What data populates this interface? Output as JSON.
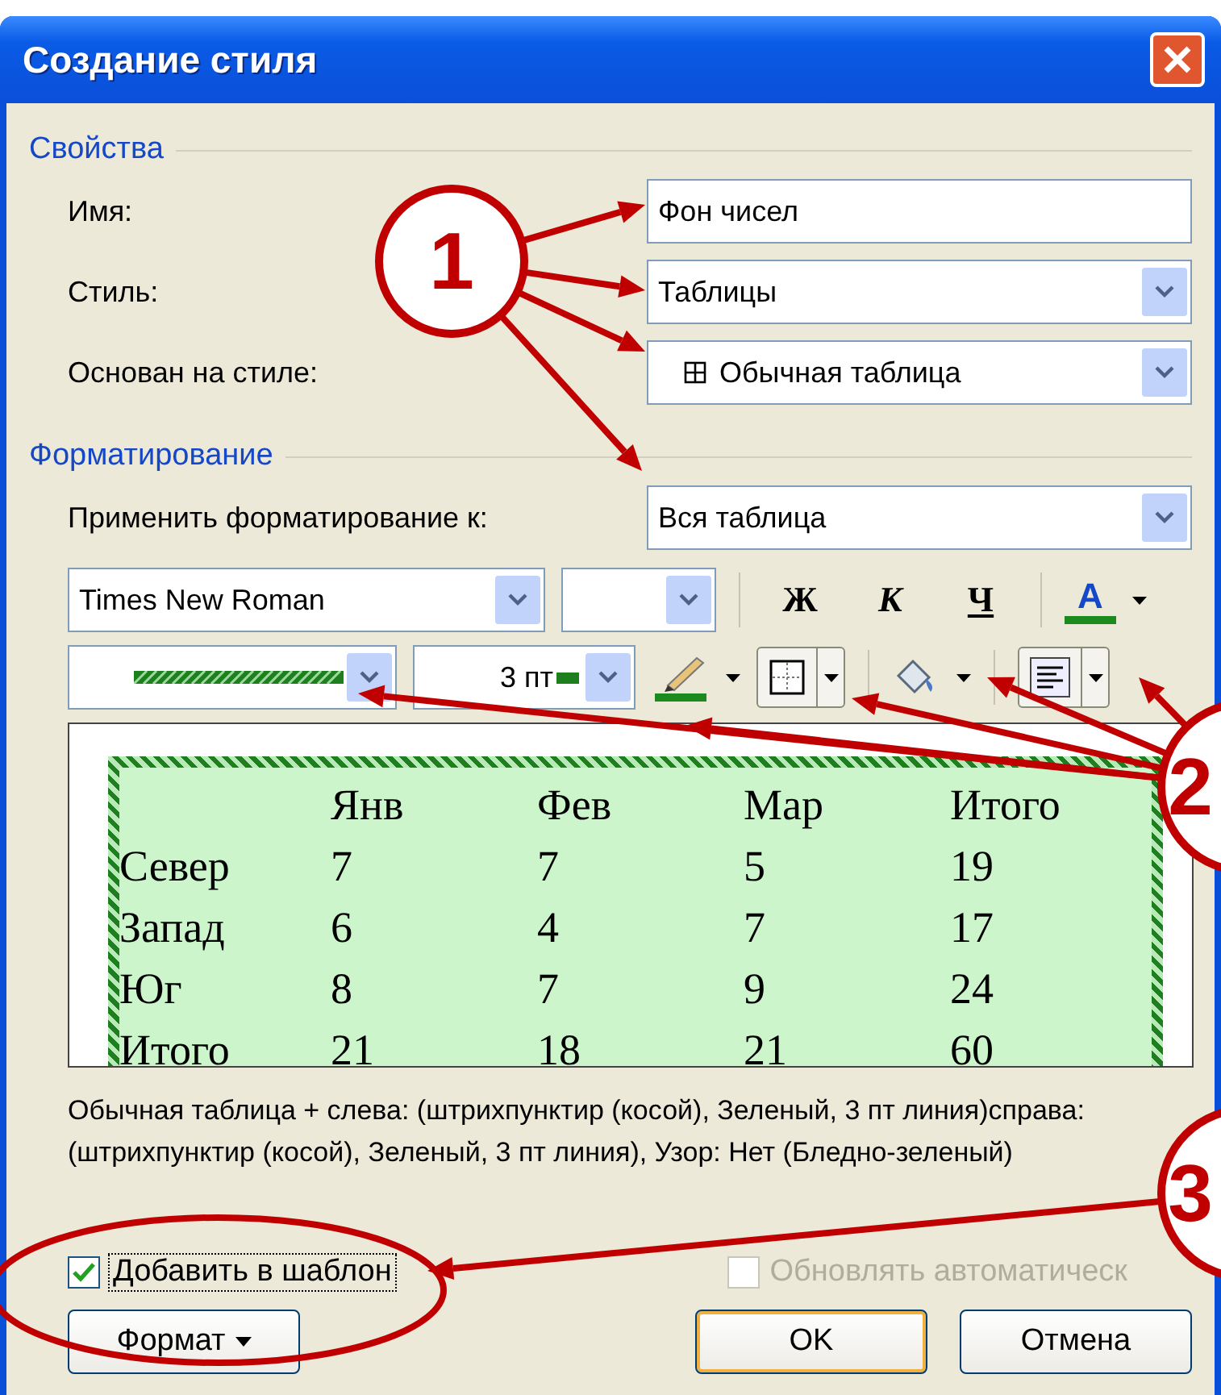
{
  "window": {
    "title": "Создание стиля"
  },
  "properties": {
    "heading": "Свойства",
    "fields": [
      {
        "label": "Имя:",
        "value": "Фон чисел",
        "kind": "text"
      },
      {
        "label": "Стиль:",
        "value": "Таблицы",
        "kind": "combo"
      },
      {
        "label": "Основан на стиле:",
        "value": "Обычная таблица",
        "kind": "table-combo"
      }
    ]
  },
  "formatting": {
    "heading": "Форматирование",
    "apply_to": {
      "label": "Применить форматирование к:",
      "value": "Вся таблица"
    },
    "font": "Times New Roman",
    "format_buttons": [
      "Ж",
      "К",
      "Ч"
    ],
    "font_color_button": "A",
    "border_width": "3 пт",
    "preview": {
      "columns": [
        "",
        "Янв",
        "Фев",
        "Мар",
        "Итого"
      ],
      "rows": [
        [
          "Север",
          "7",
          "7",
          "5",
          "19"
        ],
        [
          "Запад",
          "6",
          "4",
          "7",
          "17"
        ],
        [
          "Юг",
          "8",
          "7",
          "9",
          "24"
        ],
        [
          "Итого",
          "21",
          "18",
          "21",
          "60"
        ]
      ]
    },
    "description": "Обычная таблица + слева: (штрихпунктир (косой), Зеленый,  3 пт линия)справа: (штрихпунктир (косой), Зеленый,  3 пт линия), Узор: Нет (Бледно-зеленый)"
  },
  "options": [
    {
      "label": "Добавить в шаблон",
      "checked": true,
      "disabled": false
    },
    {
      "label": "Обновлять автоматическ",
      "checked": false,
      "disabled": true
    }
  ],
  "buttons": [
    {
      "label": "Формат",
      "kind": "menu"
    },
    {
      "label": "OK",
      "kind": "default"
    },
    {
      "label": "Отмена",
      "kind": "normal"
    }
  ],
  "callouts": [
    "1",
    "2",
    "3"
  ]
}
